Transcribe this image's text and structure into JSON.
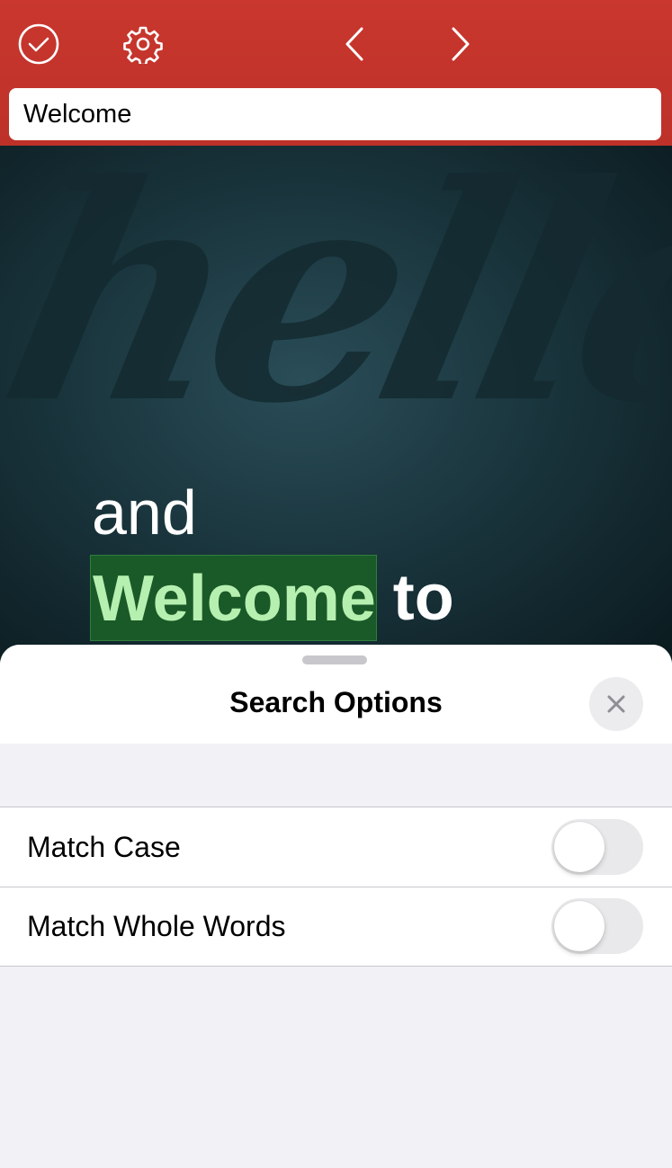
{
  "toolbar": {
    "done_icon": "checkmark-circle-icon",
    "settings_icon": "gear-icon",
    "prev_icon": "chevron-left-icon",
    "next_icon": "chevron-right-icon",
    "search_value": "Welcome",
    "bar_color": "#c9372e"
  },
  "document": {
    "script_text": "hello",
    "line1": "and",
    "highlighted_match": "Welcome",
    "after_match": "to",
    "highlight_color": "#1a5a28"
  },
  "sheet": {
    "title": "Search Options",
    "close_icon": "close-icon",
    "options": [
      {
        "label": "Match Case",
        "enabled": false
      },
      {
        "label": "Match Whole Words",
        "enabled": false
      }
    ]
  }
}
